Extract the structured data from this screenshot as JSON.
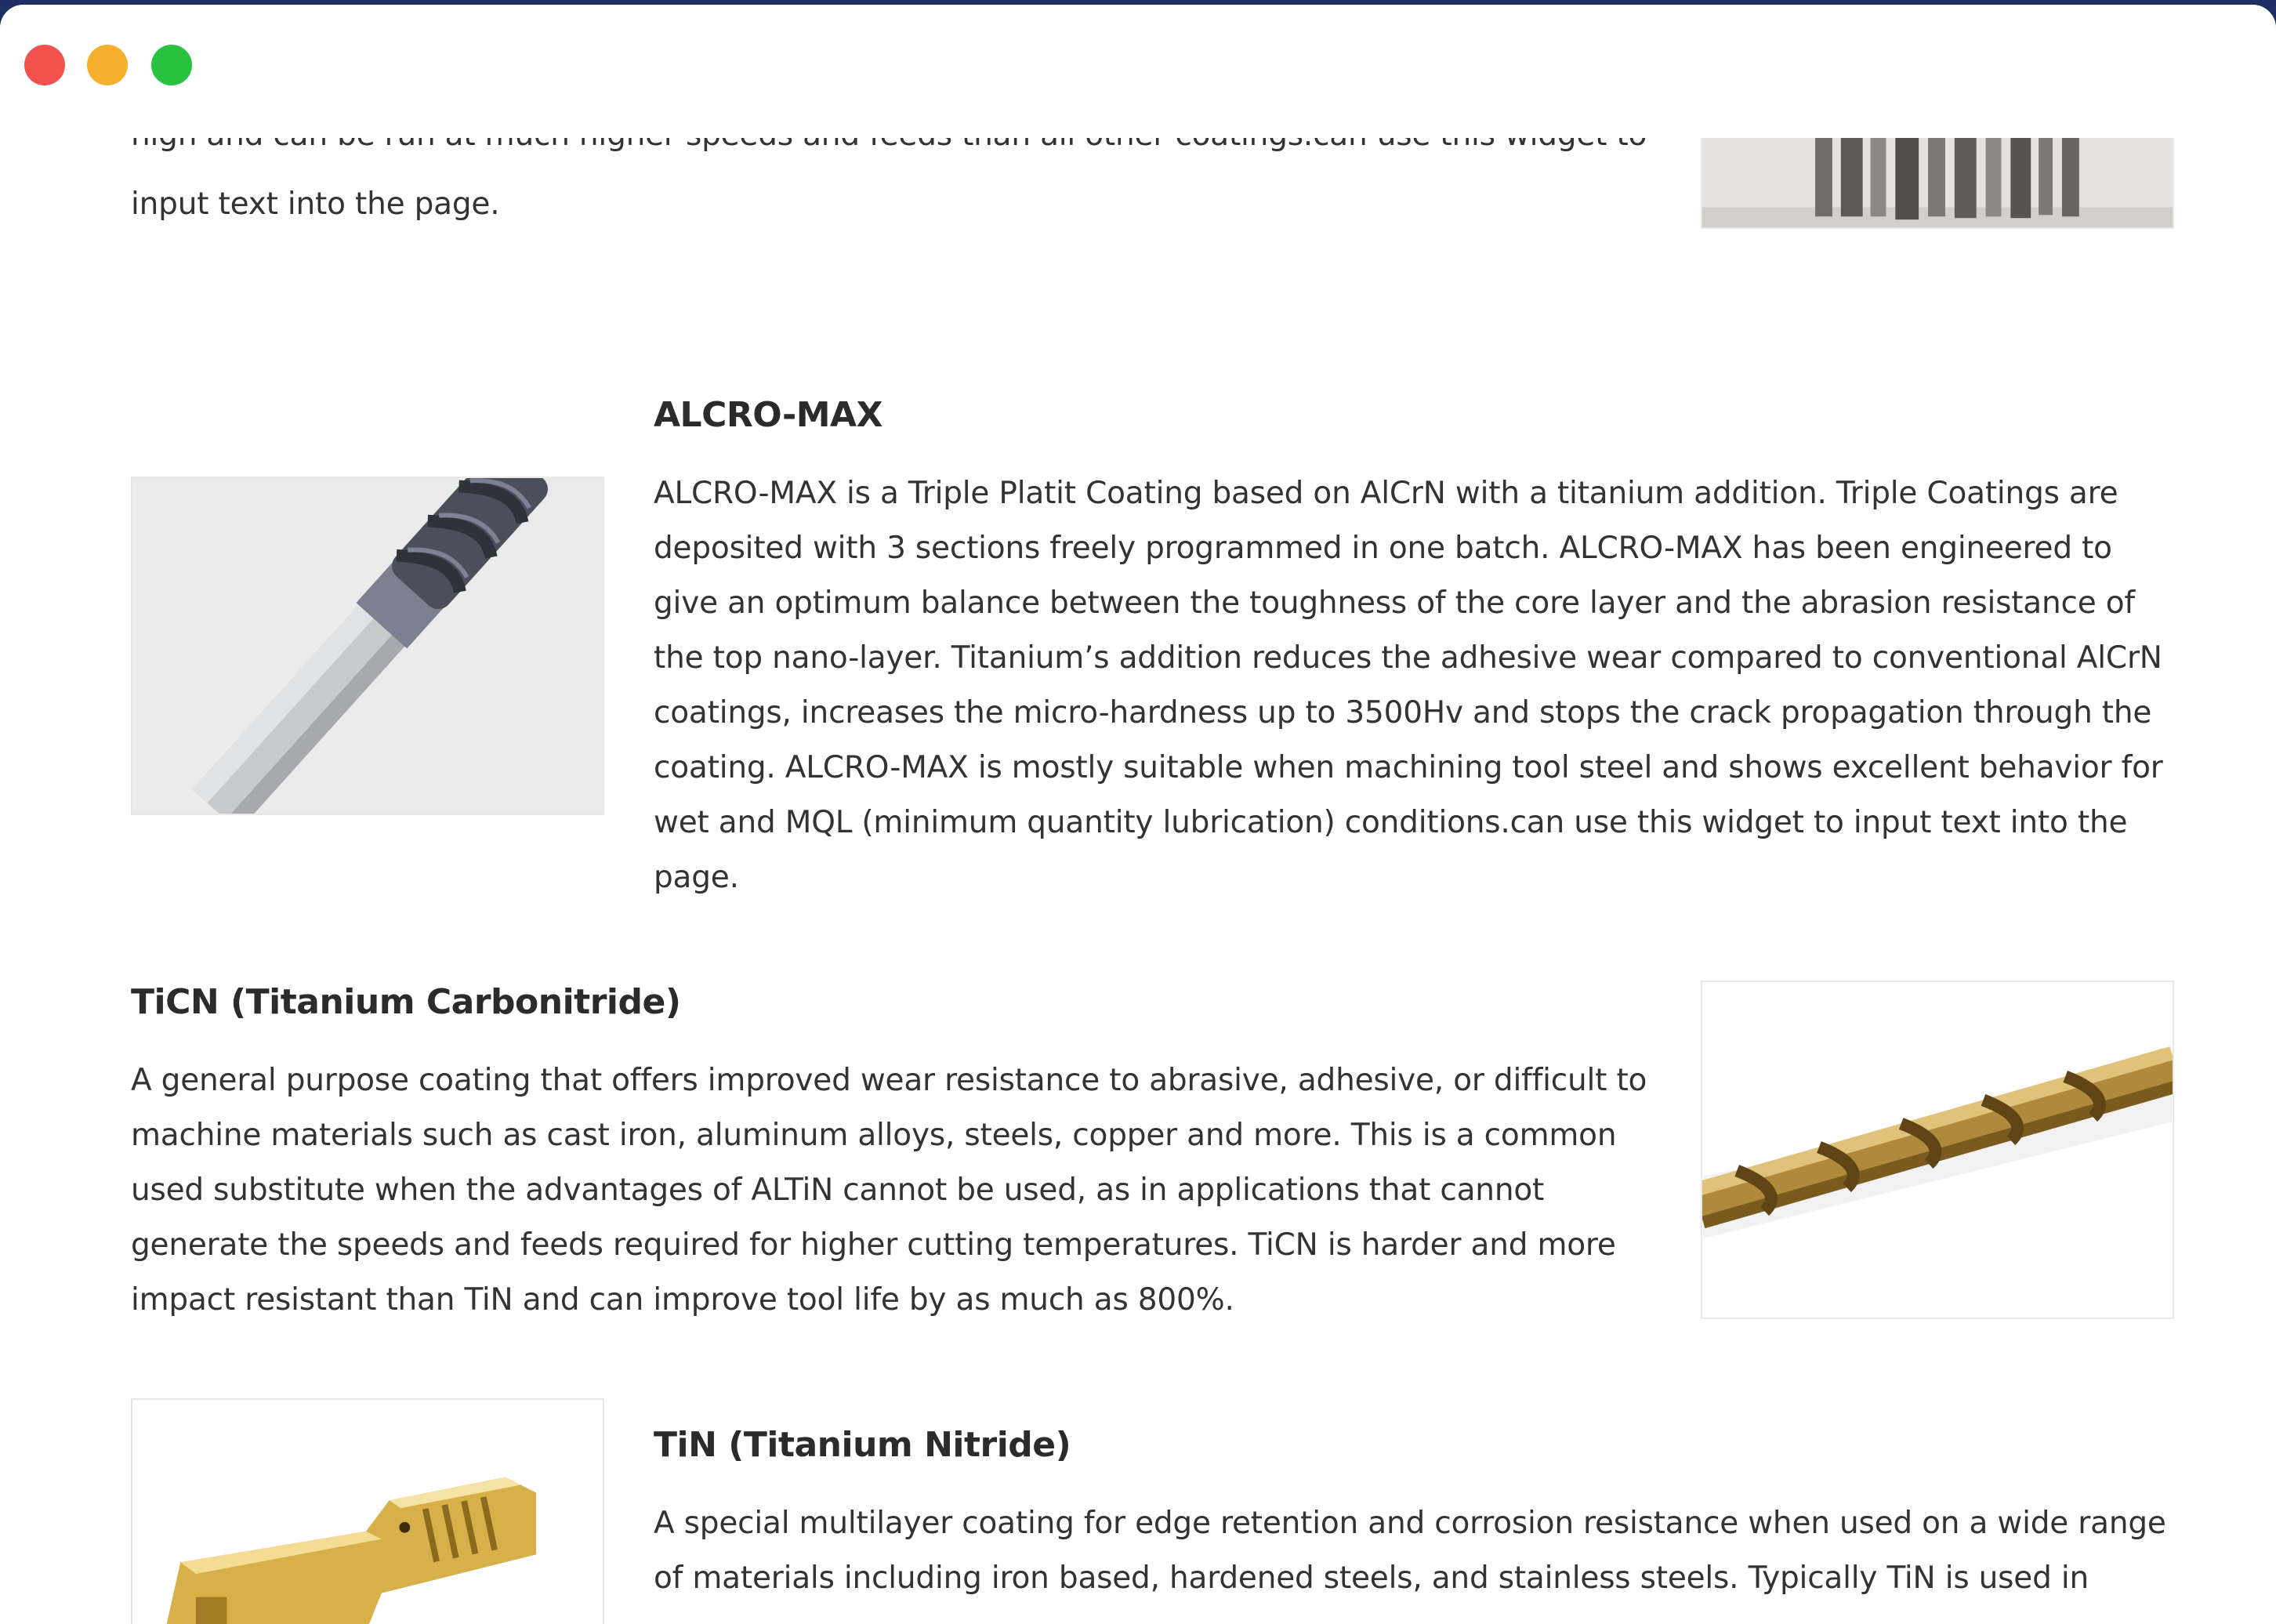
{
  "top_section": {
    "clipped_line": "high and can be run at much higher speeds and feeds than all other coatings.can use this widget to",
    "last_line": "input text into the page.",
    "image_name": "end-mills-image"
  },
  "alcro_max": {
    "title": "ALCRO-MAX",
    "body": "ALCRO-MAX is a Triple Platit Coating based on AlCrN with a titanium addition. Triple Coatings are deposited with 3 sections freely programmed in one batch. ALCRO-MAX has been engineered to give an optimum balance between the toughness of the core layer and the abrasion resistance of the top nano-layer. Titanium’s addition reduces the adhesive wear compared to conventional AlCrN coatings, increases the micro-hardness up to 3500Hv and stops the crack propagation through the coating. ALCRO-MAX is mostly suitable when machining tool steel and shows excellent behavior for wet and MQL (minimum quantity lubrication) conditions.can use this widget to input text into the page."
  },
  "ticn": {
    "title": "TiCN (Titanium Carbonitride)",
    "body": "A general purpose coating that offers improved wear resistance to abrasive, adhesive, or difficult to machine materials such as cast iron, aluminum alloys, steels, copper and more. This is a common used substitute when the advantages of ALTiN cannot be used, as in applications that cannot generate the speeds and feeds required for higher cutting temperatures. TiCN is harder and more impact resistant than TiN and can improve tool life by as much as 800%."
  },
  "tin": {
    "title": "TiN (Titanium Nitride)",
    "body": "A special multilayer coating for edge retention and corrosion resistance when used on a wide range of materials including iron based, hardened steels, and stainless steels. Typically TiN is used in"
  },
  "colors": {
    "text": "#333333",
    "heading": "#2b2b2b",
    "close": "#f2524e",
    "minimize": "#f6b02e",
    "zoom": "#29c23e"
  }
}
